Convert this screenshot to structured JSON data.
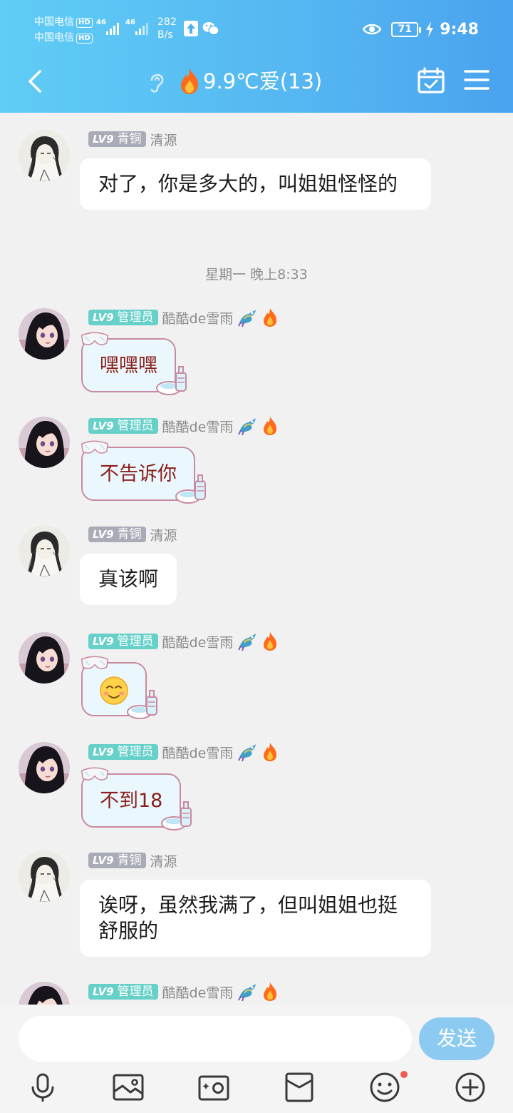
{
  "status_bar": {
    "carrier1": "中国电信",
    "carrier2": "中国电信",
    "hd_badge": "HD",
    "net1": "46",
    "net2": "46",
    "speed_value": "282",
    "speed_unit": "B/s",
    "battery": "71",
    "time": "9:48",
    "icons": [
      "upload-arrow-icon",
      "wechat-icon",
      "eye-icon",
      "battery-icon",
      "charging-icon"
    ]
  },
  "header": {
    "title": "9.9℃爱(13)",
    "icons": [
      "back-icon",
      "ear-icon",
      "fire-icon",
      "calendar-check-icon",
      "menu-icon"
    ]
  },
  "messages": [
    {
      "level": "LV9",
      "badge": "青铜",
      "name": "清源",
      "text": "对了，你是多大的，叫姐姐怪怪的",
      "style": "white"
    },
    {
      "timestamp": "星期一 晚上8:33"
    },
    {
      "level": "LV9",
      "badge": "管理员",
      "name": "酷酷de雪雨",
      "text": "嘿嘿嘿",
      "style": "decorated"
    },
    {
      "level": "LV9",
      "badge": "管理员",
      "name": "酷酷de雪雨",
      "text": "不告诉你",
      "style": "decorated"
    },
    {
      "level": "LV9",
      "badge": "青铜",
      "name": "清源",
      "text": "真该啊",
      "style": "white"
    },
    {
      "level": "LV9",
      "badge": "管理员",
      "name": "酷酷de雪雨",
      "text": "",
      "emoji": "smile-emoji",
      "style": "decorated"
    },
    {
      "level": "LV9",
      "badge": "管理员",
      "name": "酷酷de雪雨",
      "text": "不到18",
      "style": "decorated"
    },
    {
      "level": "LV9",
      "badge": "青铜",
      "name": "清源",
      "text": "诶呀，虽然我满了，但叫姐姐也挺舒服的",
      "style": "white"
    },
    {
      "level": "LV9",
      "badge": "管理员",
      "name": "酷酷de雪雨",
      "text": "",
      "style": "decorated"
    }
  ],
  "input": {
    "value": "",
    "send_label": "发送"
  },
  "toolbar": [
    "microphone-icon",
    "image-icon",
    "camera-icon",
    "red-packet-icon",
    "emoji-icon",
    "plus-icon"
  ],
  "colors": {
    "header_gradient_start": "#5fcdf5",
    "header_gradient_end": "#4aa3ee",
    "bronze_badge": "#a9acb7",
    "admin_badge": "#66d0c9",
    "send_button": "#8dcaf2"
  }
}
